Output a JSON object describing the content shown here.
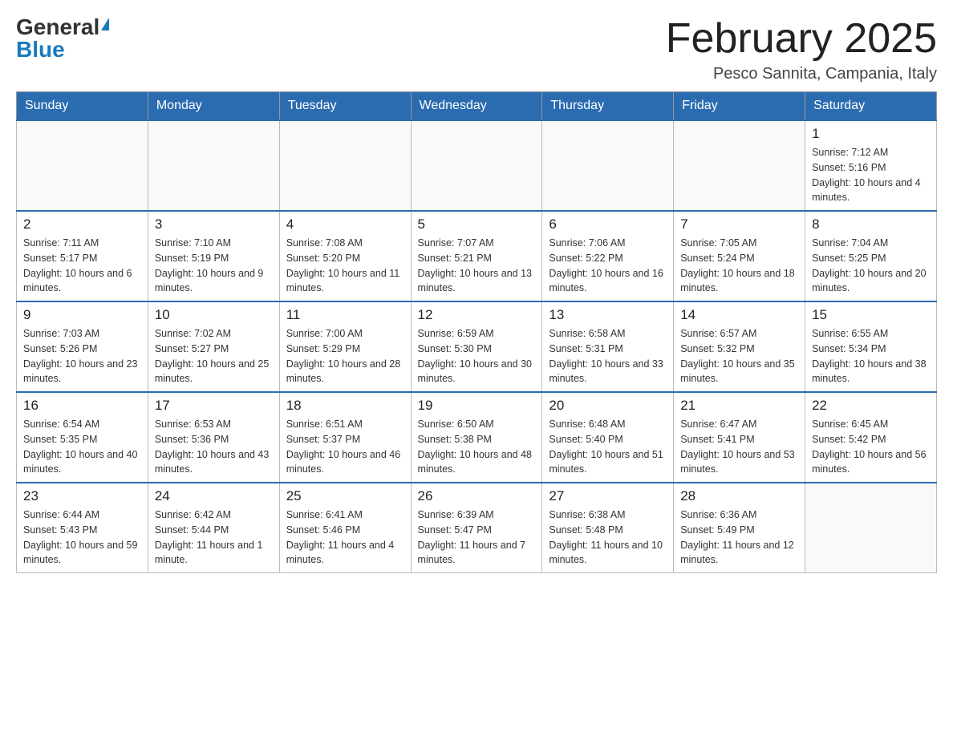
{
  "header": {
    "logo_general": "General",
    "logo_blue": "Blue",
    "month_title": "February 2025",
    "location": "Pesco Sannita, Campania, Italy"
  },
  "days_of_week": [
    "Sunday",
    "Monday",
    "Tuesday",
    "Wednesday",
    "Thursday",
    "Friday",
    "Saturday"
  ],
  "weeks": [
    [
      {
        "day": "",
        "info": ""
      },
      {
        "day": "",
        "info": ""
      },
      {
        "day": "",
        "info": ""
      },
      {
        "day": "",
        "info": ""
      },
      {
        "day": "",
        "info": ""
      },
      {
        "day": "",
        "info": ""
      },
      {
        "day": "1",
        "info": "Sunrise: 7:12 AM\nSunset: 5:16 PM\nDaylight: 10 hours and 4 minutes."
      }
    ],
    [
      {
        "day": "2",
        "info": "Sunrise: 7:11 AM\nSunset: 5:17 PM\nDaylight: 10 hours and 6 minutes."
      },
      {
        "day": "3",
        "info": "Sunrise: 7:10 AM\nSunset: 5:19 PM\nDaylight: 10 hours and 9 minutes."
      },
      {
        "day": "4",
        "info": "Sunrise: 7:08 AM\nSunset: 5:20 PM\nDaylight: 10 hours and 11 minutes."
      },
      {
        "day": "5",
        "info": "Sunrise: 7:07 AM\nSunset: 5:21 PM\nDaylight: 10 hours and 13 minutes."
      },
      {
        "day": "6",
        "info": "Sunrise: 7:06 AM\nSunset: 5:22 PM\nDaylight: 10 hours and 16 minutes."
      },
      {
        "day": "7",
        "info": "Sunrise: 7:05 AM\nSunset: 5:24 PM\nDaylight: 10 hours and 18 minutes."
      },
      {
        "day": "8",
        "info": "Sunrise: 7:04 AM\nSunset: 5:25 PM\nDaylight: 10 hours and 20 minutes."
      }
    ],
    [
      {
        "day": "9",
        "info": "Sunrise: 7:03 AM\nSunset: 5:26 PM\nDaylight: 10 hours and 23 minutes."
      },
      {
        "day": "10",
        "info": "Sunrise: 7:02 AM\nSunset: 5:27 PM\nDaylight: 10 hours and 25 minutes."
      },
      {
        "day": "11",
        "info": "Sunrise: 7:00 AM\nSunset: 5:29 PM\nDaylight: 10 hours and 28 minutes."
      },
      {
        "day": "12",
        "info": "Sunrise: 6:59 AM\nSunset: 5:30 PM\nDaylight: 10 hours and 30 minutes."
      },
      {
        "day": "13",
        "info": "Sunrise: 6:58 AM\nSunset: 5:31 PM\nDaylight: 10 hours and 33 minutes."
      },
      {
        "day": "14",
        "info": "Sunrise: 6:57 AM\nSunset: 5:32 PM\nDaylight: 10 hours and 35 minutes."
      },
      {
        "day": "15",
        "info": "Sunrise: 6:55 AM\nSunset: 5:34 PM\nDaylight: 10 hours and 38 minutes."
      }
    ],
    [
      {
        "day": "16",
        "info": "Sunrise: 6:54 AM\nSunset: 5:35 PM\nDaylight: 10 hours and 40 minutes."
      },
      {
        "day": "17",
        "info": "Sunrise: 6:53 AM\nSunset: 5:36 PM\nDaylight: 10 hours and 43 minutes."
      },
      {
        "day": "18",
        "info": "Sunrise: 6:51 AM\nSunset: 5:37 PM\nDaylight: 10 hours and 46 minutes."
      },
      {
        "day": "19",
        "info": "Sunrise: 6:50 AM\nSunset: 5:38 PM\nDaylight: 10 hours and 48 minutes."
      },
      {
        "day": "20",
        "info": "Sunrise: 6:48 AM\nSunset: 5:40 PM\nDaylight: 10 hours and 51 minutes."
      },
      {
        "day": "21",
        "info": "Sunrise: 6:47 AM\nSunset: 5:41 PM\nDaylight: 10 hours and 53 minutes."
      },
      {
        "day": "22",
        "info": "Sunrise: 6:45 AM\nSunset: 5:42 PM\nDaylight: 10 hours and 56 minutes."
      }
    ],
    [
      {
        "day": "23",
        "info": "Sunrise: 6:44 AM\nSunset: 5:43 PM\nDaylight: 10 hours and 59 minutes."
      },
      {
        "day": "24",
        "info": "Sunrise: 6:42 AM\nSunset: 5:44 PM\nDaylight: 11 hours and 1 minute."
      },
      {
        "day": "25",
        "info": "Sunrise: 6:41 AM\nSunset: 5:46 PM\nDaylight: 11 hours and 4 minutes."
      },
      {
        "day": "26",
        "info": "Sunrise: 6:39 AM\nSunset: 5:47 PM\nDaylight: 11 hours and 7 minutes."
      },
      {
        "day": "27",
        "info": "Sunrise: 6:38 AM\nSunset: 5:48 PM\nDaylight: 11 hours and 10 minutes."
      },
      {
        "day": "28",
        "info": "Sunrise: 6:36 AM\nSunset: 5:49 PM\nDaylight: 11 hours and 12 minutes."
      },
      {
        "day": "",
        "info": ""
      }
    ]
  ]
}
